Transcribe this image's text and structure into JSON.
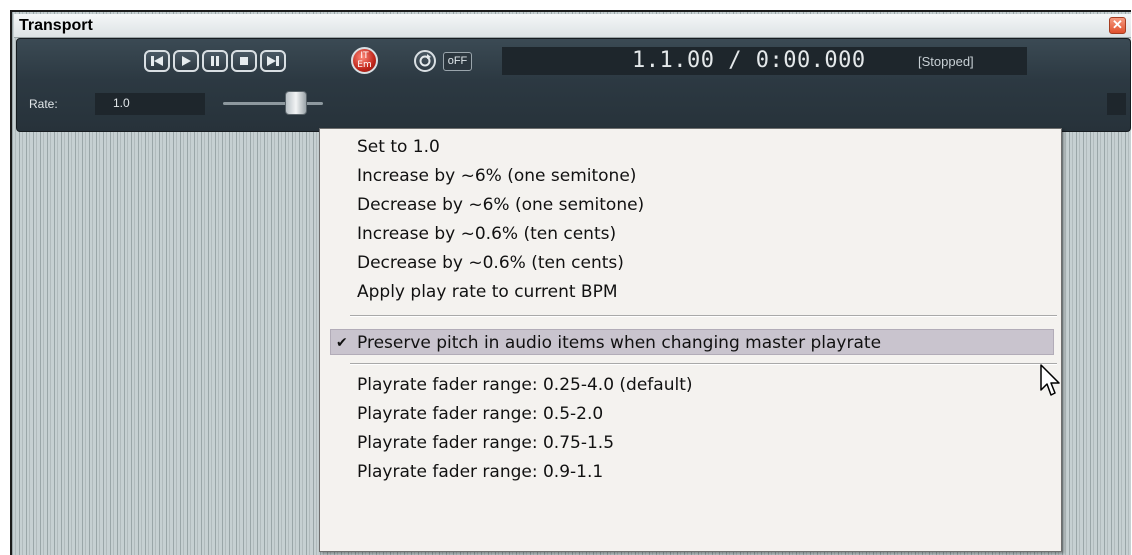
{
  "window": {
    "title": "Transport",
    "close_label": "✕"
  },
  "transport": {
    "record_label_line1": "IT",
    "record_label_line2": "Em",
    "off_label": "oFF",
    "time_display": "1.1.00 / 0:00.000",
    "state": "[Stopped]",
    "rate_label": "Rate:",
    "rate_value": "1.0",
    "buttons": [
      "go-to-start-icon",
      "play-icon",
      "pause-icon",
      "stop-icon",
      "go-to-end-icon",
      "record-icon",
      "repeat-icon"
    ]
  },
  "menu": {
    "items": [
      {
        "label": "Set to 1.0",
        "checked": false
      },
      {
        "label": "Increase by ~6% (one semitone)",
        "checked": false
      },
      {
        "label": "Decrease by ~6% (one semitone)",
        "checked": false
      },
      {
        "label": "Increase by ~0.6% (ten cents)",
        "checked": false
      },
      {
        "label": "Decrease by ~0.6% (ten cents)",
        "checked": false
      },
      {
        "label": "Apply play rate to current BPM",
        "checked": false
      },
      {
        "label": "Preserve pitch in audio items when changing master playrate",
        "checked": true,
        "highlighted": true
      },
      {
        "label": "Playrate fader range: 0.25-4.0 (default)",
        "checked": false
      },
      {
        "label": "Playrate fader range: 0.5-2.0",
        "checked": false
      },
      {
        "label": "Playrate fader range: 0.75-1.5",
        "checked": false
      },
      {
        "label": "Playrate fader range: 0.9-1.1",
        "checked": false
      }
    ],
    "check_glyph": "✔"
  },
  "colors": {
    "panel": "#2c3942",
    "menu_bg": "#f4f2ef",
    "highlight": "#c9c4ce",
    "close": "#e0512d"
  }
}
